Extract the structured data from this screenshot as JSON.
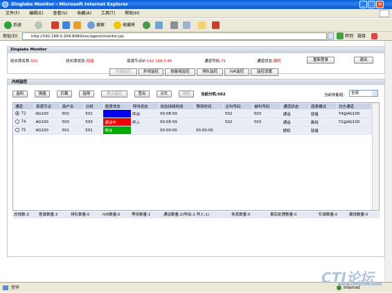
{
  "window": {
    "title": "Zinglabs Monitor - Microsoft Internet Explorer"
  },
  "menu": [
    "文件(F)",
    "编辑(E)",
    "查看(V)",
    "收藏(A)",
    "工具(T)",
    "帮助(H)"
  ],
  "toolbar": {
    "back": "后退",
    "search": "搜索",
    "favorites": "收藏夹"
  },
  "address": {
    "label": "地址(D)",
    "url": "http://192.168.0.204:8080/ssc/agent/monitor.jsp",
    "go": "转到",
    "links": "链接"
  },
  "header_panel": {
    "title": "Zinglabs Monitor",
    "leader_label": "班长席名称:",
    "leader_value": "501",
    "state_label": "班长席状态:",
    "state_value": "就绪",
    "ip_label": "资源节点IP:",
    "ip_value": "192.168.0.65",
    "channel_label": "通道号码:",
    "channel_value": "75",
    "chstate_label": "通道状态:",
    "chstate_value": "摘机",
    "relogin": "重新登录",
    "exit": "退出"
  },
  "tabs": [
    "内线监控",
    "外线监控",
    "技能组监控",
    "排队监控",
    "IVR监控",
    "监控设置"
  ],
  "monitor": {
    "title": "内线监控",
    "actions": [
      "监听",
      "强插",
      "拦截",
      "指导",
      "停止监控",
      "签出",
      "示忙",
      "闲时"
    ],
    "current_group_label": "当前分机:",
    "current_group_value": "502",
    "skill_label": "当前技能组:",
    "skill_value": "全部"
  },
  "table": {
    "headers": [
      "通道",
      "资源节点",
      "用户名",
      "分机",
      "座席状态",
      "呼叫状态",
      "状态持续时间",
      "等待时间",
      "主叫号码",
      "被叫号码",
      "通道状态",
      "座席模式",
      "对方通道"
    ],
    "rows": [
      {
        "ch": "72",
        "node": "AG100",
        "user": "502",
        "ext": "502",
        "agent": "",
        "agent_color": "#0000ee",
        "call": "呼出",
        "dur": "00:08:59",
        "wait": "",
        "caller": "502",
        "callee": "503",
        "chstate": "通话",
        "mode": "就绪",
        "peer": "74@AG100",
        "selected": true
      },
      {
        "ch": "74",
        "node": "AG100",
        "user": "503",
        "ext": "503",
        "agent": "通话中",
        "agent_color": "#ee0000",
        "call": "呼入",
        "dur": "00:08:59",
        "wait": "",
        "caller": "502",
        "callee": "503",
        "chstate": "通话",
        "mode": "离线",
        "peer": "72@AG100",
        "selected": false
      },
      {
        "ch": "75",
        "node": "AG100",
        "user": "501",
        "ext": "501",
        "agent": "等待",
        "agent_color": "#00aa00",
        "call": "",
        "dur": "00:00:00",
        "wait": "00:00:00",
        "caller": "",
        "callee": "",
        "chstate": "摘机",
        "mode": "就绪",
        "peer": "",
        "selected": false
      }
    ]
  },
  "stats": [
    "总线数:3",
    "登录数量:3",
    "排队数量:0",
    "IVR数量:0",
    "等待数量:1",
    "通话数量:2(呼出:1 呼入:1)",
    "休息数量:0",
    "事后处理数量:0",
    "忙碌数量:0",
    "离线数量:0"
  ],
  "statusbar": {
    "text": "完毕",
    "zone": "Internet"
  },
  "watermark": {
    "main": "CTI论坛",
    "sub": "www.ctiforum.com"
  }
}
